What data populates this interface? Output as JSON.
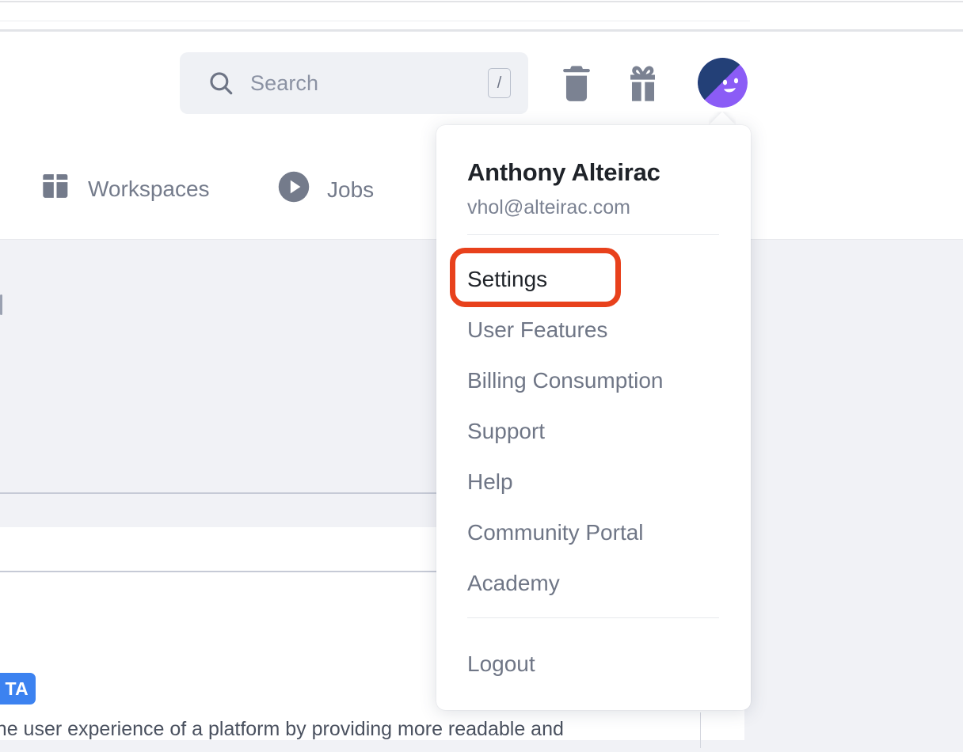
{
  "header": {
    "search": {
      "placeholder": "Search",
      "shortcut_key": "/",
      "icon": "search-icon"
    },
    "actions": [
      {
        "name": "trash-icon",
        "label": "Trash"
      },
      {
        "name": "gift-icon",
        "label": "Gift"
      }
    ],
    "avatar": {
      "name": "user-avatar",
      "colors": {
        "base": "#8b5cf6",
        "wedge": "#234077"
      }
    }
  },
  "navbar": {
    "items": [
      {
        "label": "Workspaces",
        "icon": "box-icon"
      },
      {
        "label": "Jobs",
        "icon": "play-circle-icon"
      }
    ]
  },
  "dropdown": {
    "user": {
      "name": "Anthony Alteirac",
      "email": "vhol@alteirac.com"
    },
    "items": [
      {
        "label": "Settings",
        "active": true
      },
      {
        "label": "User Features",
        "active": false
      },
      {
        "label": "Billing Consumption",
        "active": false
      },
      {
        "label": "Support",
        "active": false
      },
      {
        "label": "Help",
        "active": false
      },
      {
        "label": "Community Portal",
        "active": false
      },
      {
        "label": "Academy",
        "active": false
      }
    ],
    "logout": {
      "label": "Logout"
    }
  },
  "content": {
    "badge": "TA",
    "body_text": "ces the user experience of a platform by providing more readable and"
  },
  "annotation": {
    "target": "Settings",
    "color": "#e8411c"
  }
}
